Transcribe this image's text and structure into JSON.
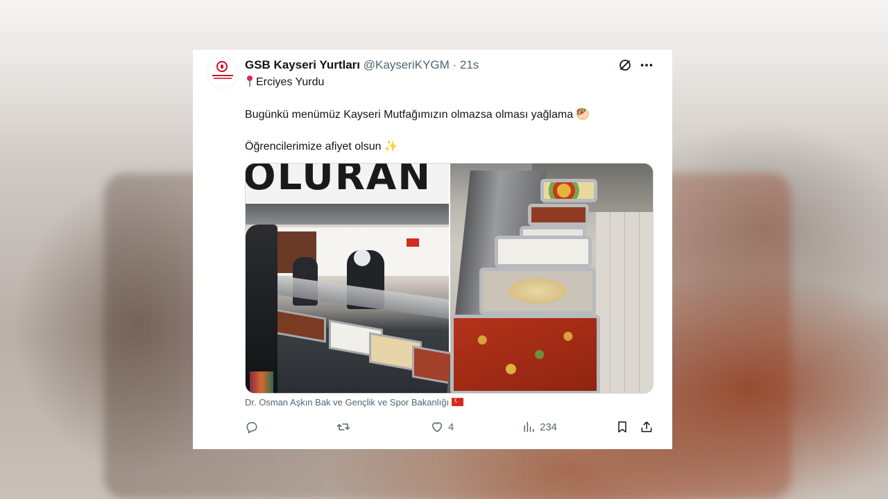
{
  "tweet": {
    "author_name": "GSB Kayseri Yurtları",
    "handle": "@KayseriKYGM",
    "separator": "·",
    "time": "21s",
    "location_line": "Erciyes Yurdu",
    "body_line1": "Bugünkü menümüz Kayseri Mutfağımızın olmazsa olması yağlama",
    "body_line1_emoji": "🥙",
    "body_line2": "Öğrencilerimize afiyet olsun",
    "body_line2_emoji": "✨",
    "media_caption": "Dr. Osman Aşkın Bak ve Gençlik ve Spor Bakanlığı",
    "actions": {
      "reply_count": "",
      "retweet_count": "",
      "like_count": "4",
      "views_count": "234"
    }
  },
  "background": {
    "sign_text": "OLURAN"
  },
  "icons": {
    "grok": "grok-slash-circle-icon",
    "more": "more-dots-icon",
    "reply": "reply-icon",
    "retweet": "retweet-icon",
    "like": "heart-icon",
    "views": "views-bar-icon",
    "bookmark": "bookmark-icon",
    "share": "share-icon"
  },
  "colors": {
    "text_primary": "#0f1419",
    "text_secondary": "#536471",
    "border": "#cfd9de"
  }
}
